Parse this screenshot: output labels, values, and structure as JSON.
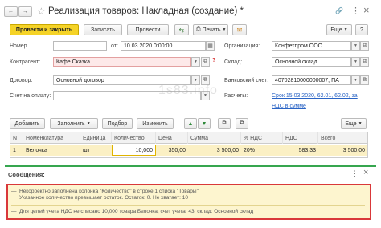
{
  "window": {
    "title": "Реализация товаров: Накладная (создание) *",
    "nav_back": "←",
    "nav_forward": "→",
    "star": "☆",
    "link_icon": "🔗",
    "menu_icon": "⋮",
    "close_icon": "×"
  },
  "toolbar": {
    "post_close": "Провести и закрыть",
    "save": "Записать",
    "post": "Провести",
    "print": "Печать",
    "more": "Еще",
    "help": "?"
  },
  "form": {
    "number_label": "Номер",
    "number_value": "",
    "from_label": "от:",
    "date_value": "10.03.2020  0:00:00",
    "org_label": "Организация:",
    "org_value": "Конфетпром ООО",
    "contractor_label": "Контрагент:",
    "contractor_value": "Кафе Сказка",
    "warehouse_label": "Склад:",
    "warehouse_value": "Основной склад",
    "contract_label": "Договор:",
    "contract_value": "Основной договор",
    "bank_label": "Банковский счет:",
    "bank_value": "40702810000000007, ПА",
    "invoice_label": "Счет на оплату:",
    "invoice_value": "",
    "settlements_label": "Расчеты:",
    "settlements_link": "Срок 15.03.2020, 62.01, 62.02, за",
    "vat_link": "НДС в сумме"
  },
  "table_toolbar": {
    "add": "Добавить",
    "fill": "Заполнить",
    "selection": "Подбор",
    "change": "Изменить",
    "more": "Еще"
  },
  "table": {
    "columns": [
      "N",
      "Номенклатура",
      "Единица",
      "Количество",
      "Цена",
      "Сумма",
      "% НДС",
      "НДС",
      "Всего"
    ],
    "rows": [
      [
        "1",
        "Белочка",
        "шт",
        "10,000",
        "350,00",
        "3 500,00",
        "20%",
        "583,33",
        "3 500,00"
      ]
    ]
  },
  "messages": {
    "header": "Сообщения:",
    "items": [
      {
        "line1": "Некорректно заполнена колонка \"Количество\" в строке 1 списка \"Товары\"",
        "line2": "Указанное количество превышает остаток. Остаток: 0. Не хватает: 10"
      },
      {
        "line1": "Для целей учета НДС не списано 10,000 товара Белочка, счет учета: 43, склад: Основной склад"
      }
    ]
  },
  "watermark": "1s83.info",
  "colors": {
    "accent_yellow": "#f5d327",
    "error_red": "#d9383a",
    "link_blue": "#2a64c5",
    "selected_row": "#fbf0c4",
    "message_bg": "#fdf5cf",
    "divider_green": "#36a64f"
  }
}
